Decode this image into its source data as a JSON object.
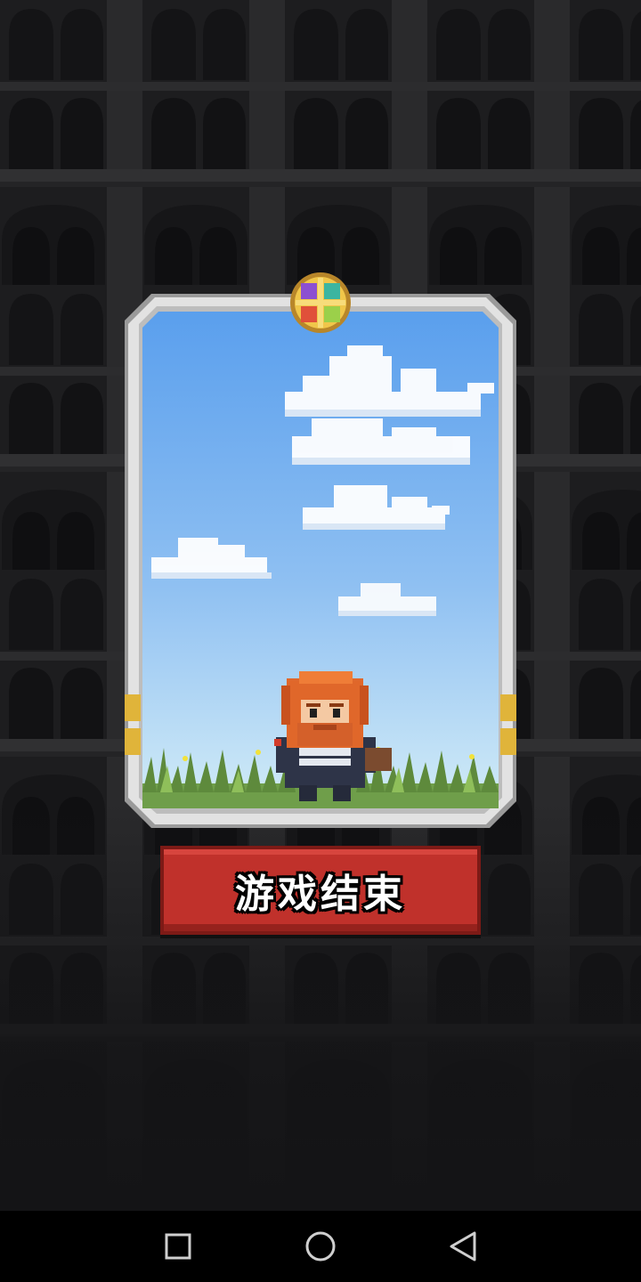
{
  "screen": {
    "button": {
      "label": "游戏结束"
    }
  },
  "navigation_bar": {
    "buttons": [
      "recent-apps",
      "home",
      "back"
    ]
  },
  "colors": {
    "background": "#1b1b1d",
    "sky_top": "#5a9fed",
    "sky_bottom": "#cfe9f7",
    "button_red": "#c0312b",
    "frame_silver": "#d8d8d8",
    "hair_orange": "#e0672a"
  }
}
